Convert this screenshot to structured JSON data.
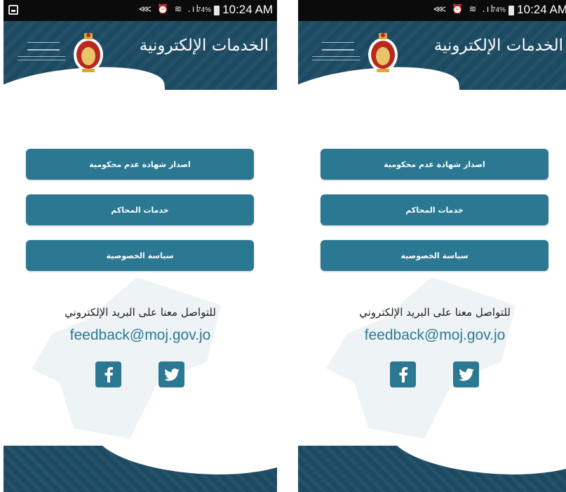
{
  "status_bar": {
    "icons_text": "⋘ ⏰ ≋ .ıl",
    "battery_percent": "74%",
    "time": "10:24 AM"
  },
  "header": {
    "title": "الخدمات الإلكترونية"
  },
  "buttons": {
    "issue_certificate": "اصدار شهادة عدم محكومية",
    "court_services": "خدمات المحاكم",
    "privacy_policy": "سياسة الخصوصية"
  },
  "contact": {
    "prompt": "للتواصل معنا على البريد الإلكتروني",
    "email": "feedback@moj.gov.jo"
  },
  "social": {
    "facebook_glyph": "f"
  },
  "colors": {
    "header_bg": "#1d4a63",
    "button_bg": "#2b7892",
    "email_text": "#2c7a96"
  }
}
